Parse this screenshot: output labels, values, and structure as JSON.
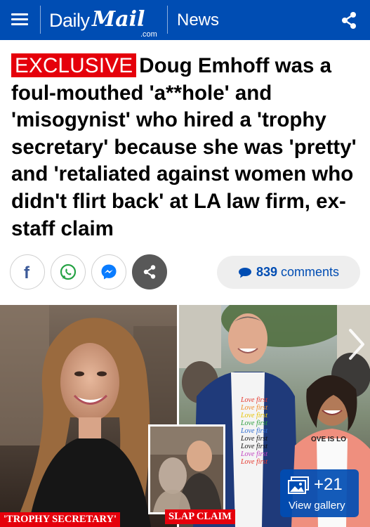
{
  "header": {
    "logo_daily": "Daily",
    "logo_mail": "Mail",
    "logo_com": ".com",
    "channel": "News",
    "background_color": "#004db3"
  },
  "article": {
    "badge": "EXCLUSIVE",
    "headline": "Doug Emhoff was a foul-mouthed 'a**hole' and 'misogynist' who hired a 'trophy secretary' because she was 'pretty' and 'retaliated against women who didn't flirt back' at LA law firm, ex-staff claim",
    "badge_color": "#e5000b"
  },
  "share": {
    "buttons": [
      "facebook-icon",
      "whatsapp-icon",
      "messenger-icon",
      "share-icon"
    ],
    "comments_count": "839",
    "comments_label": "comments"
  },
  "gallery": {
    "caption_left": "'TROPHY SECRETARY'",
    "caption_right": "SLAP CLAIM",
    "shirt_text": [
      "Love first",
      "Love first",
      "Love first",
      "Love first",
      "Love first",
      "Love first",
      "Love first",
      "Love first",
      "Love first"
    ],
    "shirt_right_text": "OVE IS LO",
    "count_label": "+21",
    "view_gallery_label": "View gallery"
  }
}
